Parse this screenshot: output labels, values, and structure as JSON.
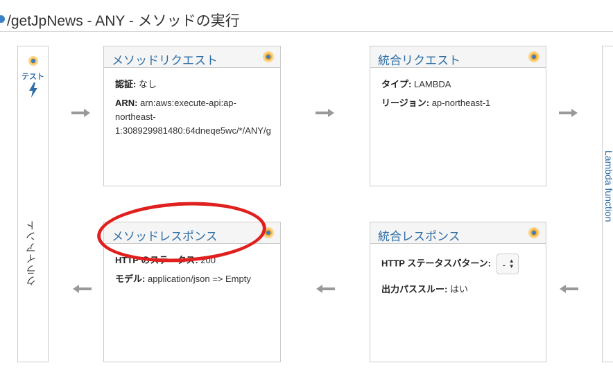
{
  "header": {
    "title": "/getJpNews - ANY - メソッドの実行"
  },
  "client": {
    "test_label": "テスト",
    "label": "クライアント"
  },
  "method_request": {
    "title": "メソッドリクエスト",
    "auth_label": "認証:",
    "auth_value": "なし",
    "arn_label": "ARN:",
    "arn_line1": "arn:aws:execute-api:ap-",
    "arn_line2": "northeast-",
    "arn_line3": "1:308929981480:64dneqe5wc/*/ANY/g"
  },
  "integration_request": {
    "title": "統合リクエスト",
    "type_label": "タイプ:",
    "type_value": "LAMBDA",
    "region_label": "リージョン:",
    "region_value": "ap-northeast-1"
  },
  "method_response": {
    "title": "メソッドレスポンス",
    "status_label": "HTTP のステータス:",
    "status_value": "200",
    "model_label": "モデル:",
    "model_value": "application/json => Empty"
  },
  "integration_response": {
    "title": "統合レスポンス",
    "pattern_label": "HTTP ステータスパターン:",
    "pattern_value": "-",
    "passthrough_label": "出力パススルー:",
    "passthrough_value": "はい"
  },
  "right_panel": {
    "label": "Lambda function"
  },
  "colors": {
    "accent": "#2e6ea6",
    "highlight_circle": "#e0201e",
    "status_dot": "#f5a623"
  }
}
